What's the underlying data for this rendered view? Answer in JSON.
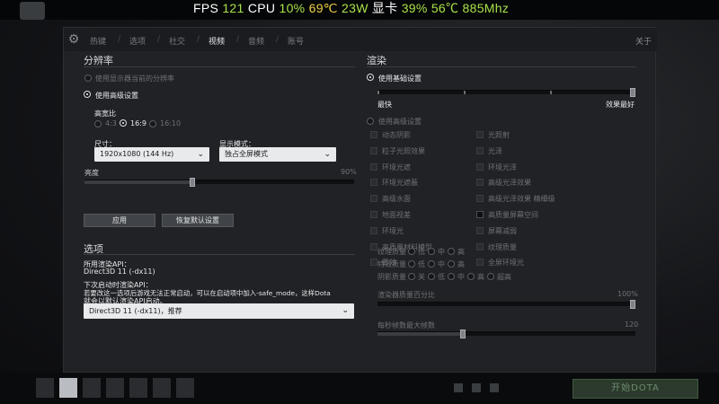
{
  "osd": {
    "fps_label": "FPS",
    "fps": "121",
    "cpu_label": "CPU",
    "cpu_pct": "10%",
    "cpu_temp": "69℃",
    "cpu_power": "23W",
    "gpu_label": "显卡",
    "gpu_pct": "39%",
    "gpu_temp": "56℃",
    "gpu_clock": "885Mhz"
  },
  "tabs": {
    "hotkeys": "热键",
    "options": "选项",
    "social": "社交",
    "video": "视频",
    "audio": "音频",
    "account": "账号",
    "close": "关于"
  },
  "resolution": {
    "title": "分辨率",
    "use_display_res": "使用显示器当前的分辨率",
    "use_advanced": "使用高级设置",
    "aspect_label": "高宽比",
    "aspect_options": [
      "4:3",
      "16:9",
      "16:10"
    ],
    "size_label": "尺寸：",
    "size_value": "1920x1080 (144 Hz)",
    "display_mode_label": "显示模式：",
    "display_mode_value": "独占全屏模式",
    "brightness_label": "亮度",
    "brightness_value": "90%",
    "brightness_level": 0.4,
    "apply": "应用",
    "restore": "恢复默认设置"
  },
  "options": {
    "title": "选项",
    "api_label": "所用渲染API：",
    "api_value": "Direct3D 11 (-dx11)",
    "next_api_label": "下次启动时渲染API：",
    "next_api_desc1": "若要改这一选项后游戏无法正常启动，可以在启动项中加入-safe_mode，这样Dota",
    "next_api_desc2": "就会以默认渲染API启动。",
    "api_select": "Direct3D 11 (-dx11)，推荐"
  },
  "render": {
    "title": "渲染",
    "use_basic": "使用基础设置",
    "fast": "最快",
    "best": "效果最好",
    "use_advanced": "使用高级设置",
    "checkboxes_left": [
      "动态阴影",
      "粒子光照效果",
      "环境光遮",
      "环境光遮蔽",
      "高级水面",
      "地面视差",
      "环境光",
      "高质量材料模型",
      "雾效"
    ],
    "checkboxes_right": [
      "光照射",
      "光泽",
      "环境光泽",
      "高级光泽效果",
      "高级光泽效果 精细级",
      "高质量屏幕空间",
      "屏幕减弱",
      "纹理质量",
      "全屏环境光"
    ],
    "quality_rows": [
      {
        "label": "纹理质量",
        "opts": [
          "低",
          "中",
          "高"
        ]
      },
      {
        "label": "特效质量",
        "opts": [
          "低",
          "中",
          "高"
        ]
      },
      {
        "label": "阴影质量",
        "opts": [
          "关",
          "低",
          "中",
          "高",
          "超高"
        ]
      }
    ],
    "scale_label": "渲染器质量百分比",
    "scale_value": "100%",
    "fps_label": "每秒帧数最大帧数",
    "fps_value": "120"
  },
  "bottom": {
    "play": "开始DOTA"
  }
}
